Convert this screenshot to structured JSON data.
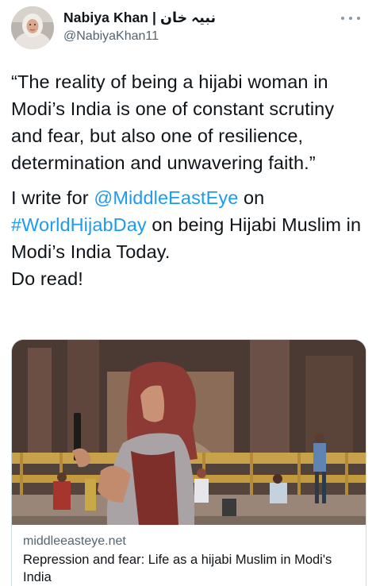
{
  "author": {
    "display_name": "Nabiya Khan | نبیہ خان",
    "handle": "@NabiyaKhan11"
  },
  "tweet": {
    "quote": "“The reality of being a hijabi woman in Modi’s India is one of constant scrutiny and fear, but also one of resilience, determination and unwavering faith.”",
    "line1_prefix": "I write for ",
    "mention": "@MiddleEastEye",
    "line1_suffix": " on",
    "hashtag": "#WorldHijabDay",
    "line2_suffix": " on being Hijabi Muslim in Modi’s India Today.",
    "closing": "Do read!"
  },
  "card": {
    "domain": "middleeasteye.net",
    "title": "Repression and fear: Life as a hijabi Muslim in Modi's India"
  },
  "icons": {
    "more": "more-dots-icon"
  },
  "colors": {
    "link": "#1d9bf0",
    "secondary_text": "#536471"
  }
}
